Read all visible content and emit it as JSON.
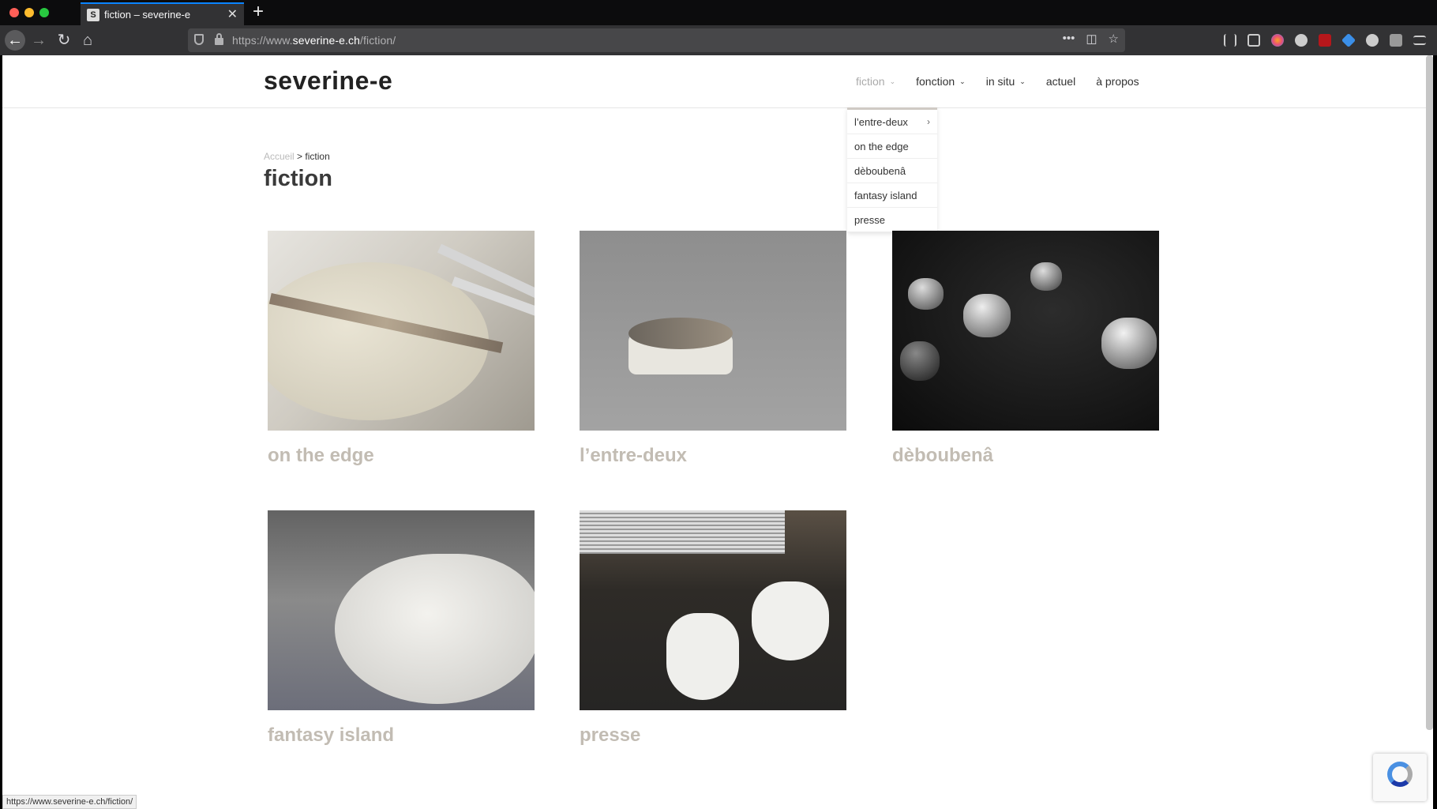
{
  "browser": {
    "tab_title": "fiction – severine-e",
    "tab_favicon_letter": "S",
    "url_prefix": "https://www.",
    "url_domain": "severine-e.ch",
    "url_path": "/fiction/",
    "status_url": "https://www.severine-e.ch/fiction/"
  },
  "site": {
    "logo": "severine-e",
    "nav": [
      {
        "label": "fiction",
        "has_children": true,
        "active": true
      },
      {
        "label": "fonction",
        "has_children": true
      },
      {
        "label": "in situ",
        "has_children": true
      },
      {
        "label": "actuel"
      },
      {
        "label": "à propos"
      }
    ],
    "dropdown": [
      {
        "label": "l’entre-deux",
        "has_submenu": true
      },
      {
        "label": "on the edge"
      },
      {
        "label": "dèboubenâ"
      },
      {
        "label": "fantasy island"
      },
      {
        "label": "presse"
      }
    ]
  },
  "breadcrumb": {
    "home": "Accueil",
    "separator": ">",
    "current": "fiction"
  },
  "page_title": "fiction",
  "gallery": [
    {
      "title": "on the edge"
    },
    {
      "title": "l’entre-deux"
    },
    {
      "title": "dèboubenâ"
    },
    {
      "title": "fantasy island"
    },
    {
      "title": "presse"
    }
  ],
  "colors": {
    "accent": "#0a84ff",
    "card_title": "#c2bcb3",
    "dropdown_border": "#cfcac4"
  }
}
